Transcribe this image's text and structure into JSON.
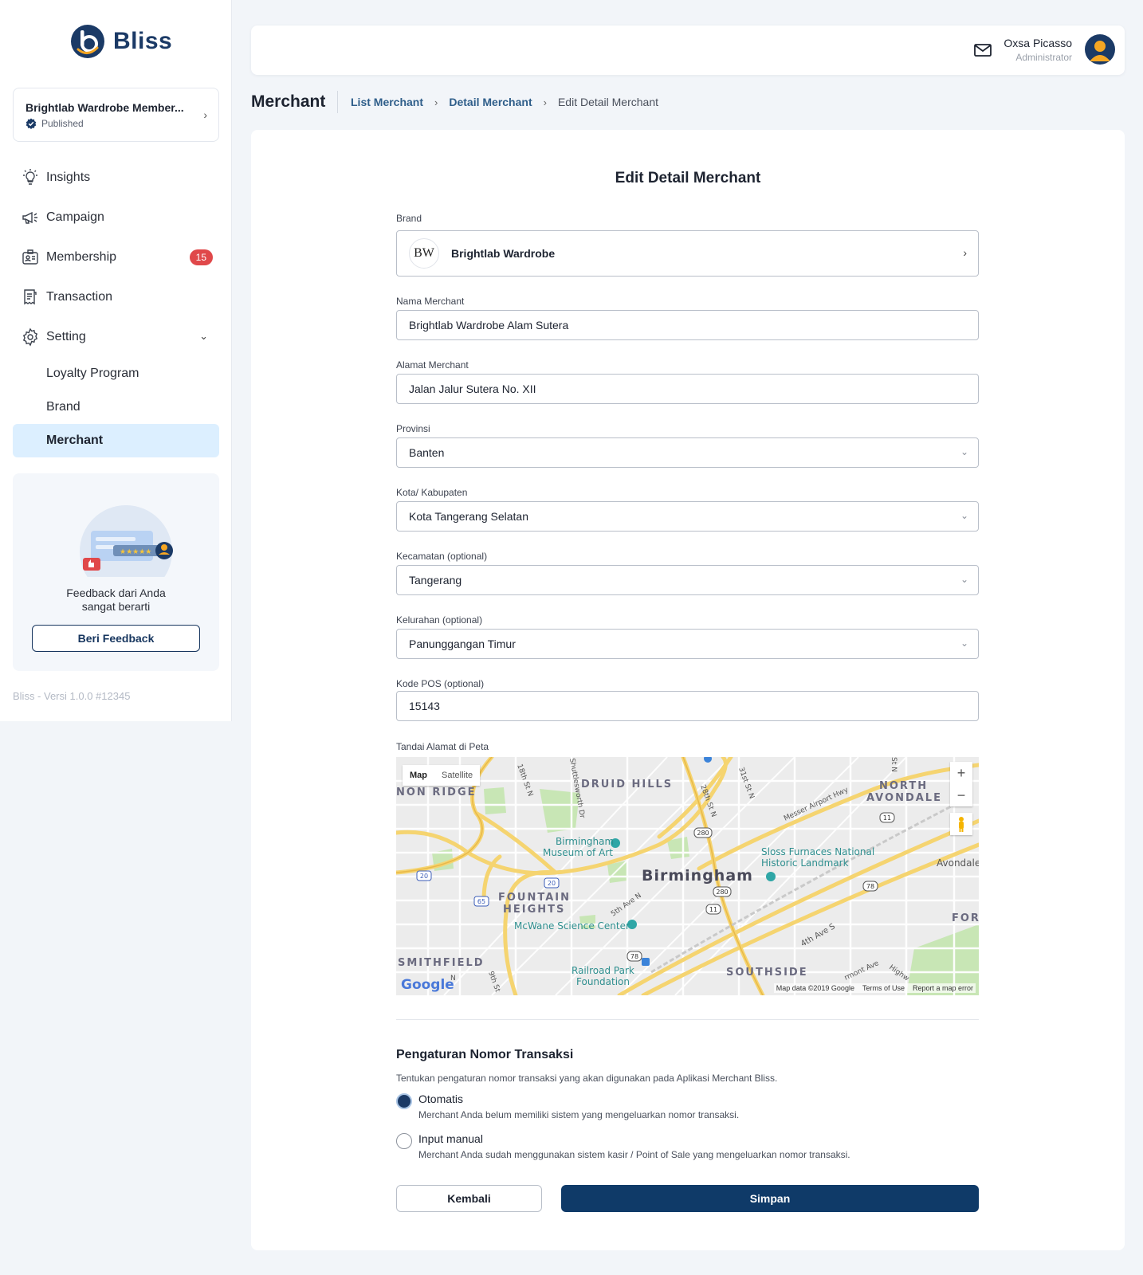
{
  "app": {
    "logo_text": "Bliss",
    "version": "Bliss - Versi 1.0.0 #12345"
  },
  "brand_selector": {
    "name": "Brightlab Wardrobe Member...",
    "status": "Published"
  },
  "sidebar": {
    "items": [
      {
        "label": "Insights",
        "icon": "lightbulb-icon"
      },
      {
        "label": "Campaign",
        "icon": "megaphone-icon"
      },
      {
        "label": "Membership",
        "icon": "member-card-icon",
        "badge": "15"
      },
      {
        "label": "Transaction",
        "icon": "receipt-icon"
      },
      {
        "label": "Setting",
        "icon": "gear-icon"
      }
    ],
    "sub_items": [
      {
        "label": "Loyalty Program"
      },
      {
        "label": "Brand"
      },
      {
        "label": "Merchant",
        "active": true
      }
    ]
  },
  "feedback": {
    "text_line1": "Feedback dari Anda",
    "text_line2": "sangat berarti",
    "button": "Beri Feedback"
  },
  "topbar": {
    "user_name": "Oxsa Picasso",
    "user_role": "Administrator"
  },
  "header": {
    "title": "Merchant",
    "breadcrumbs": [
      "List Merchant",
      "Detail Merchant",
      "Edit Detail Merchant"
    ]
  },
  "form": {
    "title": "Edit Detail Merchant",
    "brand_label": "Brand",
    "brand_logo_text": "BW",
    "brand_value": "Brightlab Wardrobe",
    "nama_label": "Nama Merchant",
    "nama_value": "Brightlab Wardrobe Alam Sutera",
    "alamat_label": "Alamat Merchant",
    "alamat_value": "Jalan Jalur Sutera No. XII",
    "provinsi_label": "Provinsi",
    "provinsi_value": "Banten",
    "kota_label": "Kota/ Kabupaten",
    "kota_value": "Kota Tangerang Selatan",
    "kecamatan_label": "Kecamatan (optional)",
    "kecamatan_value": "Tangerang",
    "kelurahan_label": "Kelurahan (optional)",
    "kelurahan_value": "Panunggangan Timur",
    "kodepos_label": "Kode POS (optional)",
    "kodepos_value": "15143",
    "map_label": "Tandai Alamat di Peta"
  },
  "map": {
    "tab_map": "Map",
    "tab_satellite": "Satellite",
    "zoom_in": "+",
    "zoom_out": "−",
    "labels": {
      "druid_hills": "DRUID HILLS",
      "north_avondale_1": "NORTH",
      "north_avondale_2": "AVONDALE",
      "non_ridge": "NON RIDGE",
      "museum_1": "Birmingham",
      "museum_2": "Museum of Art",
      "birmingham": "Birmingham",
      "sloss_1": "Sloss Furnaces National",
      "sloss_2": "Historic Landmark",
      "avondale": "Avondale",
      "fountain_1": "FOUNTAIN",
      "fountain_2": "HEIGHTS",
      "mcwane": "McWane Science Center",
      "smithfield": "SMITHFIELD",
      "railroad_1": "Railroad Park",
      "railroad_2": "Foundation",
      "southside": "SOUTHSIDE",
      "for": "FOR",
      "messer": "Messer Airport Hwy",
      "fourth_ave": "4th Ave S",
      "fifth_ave": "5th Ave N",
      "st18": "18th St N",
      "st28": "28th St N",
      "st31": "31st St N",
      "shuttlesworth": "Shuttlesworth Dr",
      "st9": "9th St",
      "stn": "St N",
      "n": "N",
      "rmont": "rmont Ave",
      "highw": "Highw",
      "shield_20a": "20",
      "shield_20b": "20",
      "shield_65": "65",
      "shield_280a": "280",
      "shield_280b": "280",
      "shield_11a": "11",
      "shield_11b": "11",
      "shield_78a": "78",
      "shield_78b": "78"
    },
    "attribution": "Map data ©2019 Google",
    "terms": "Terms of Use",
    "report": "Report a map error",
    "google": "Google"
  },
  "transaction_settings": {
    "title": "Pengaturan Nomor Transaksi",
    "description": "Tentukan pengaturan nomor transaksi yang akan digunakan pada Aplikasi Merchant Bliss.",
    "options": [
      {
        "label": "Otomatis",
        "desc": "Merchant Anda belum memiliki sistem yang mengeluarkan nomor transaksi.",
        "selected": true
      },
      {
        "label": "Input manual",
        "desc": "Merchant Anda sudah menggunakan sistem kasir / Point of Sale yang mengeluarkan nomor transaksi.",
        "selected": false
      }
    ]
  },
  "actions": {
    "back": "Kembali",
    "save": "Simpan"
  },
  "colors": {
    "primary": "#0f3a68",
    "badge": "#e0484a",
    "active_nav": "#dcefff",
    "map_road": "#f5d470"
  }
}
